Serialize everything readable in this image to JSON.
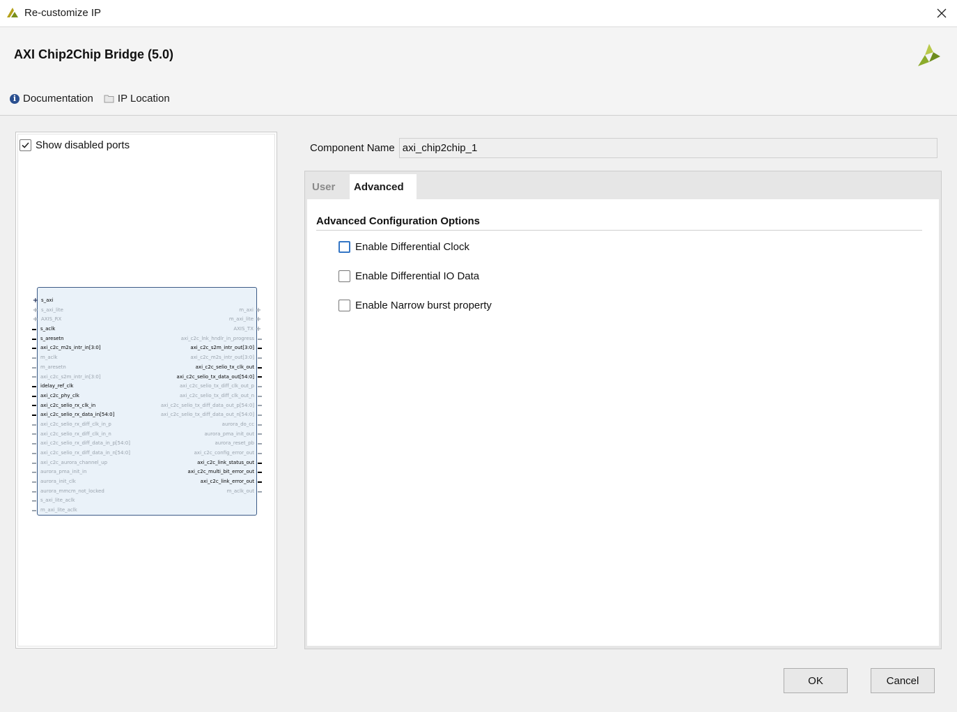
{
  "window": {
    "title": "Re-customize IP"
  },
  "header": {
    "ip_title": "AXI Chip2Chip Bridge (5.0)",
    "links": [
      {
        "label": "Documentation",
        "icon": "info-icon"
      },
      {
        "label": "IP Location",
        "icon": "folder-icon"
      }
    ]
  },
  "left_panel": {
    "show_disabled_ports": {
      "label": "Show disabled ports",
      "checked": true
    },
    "ports_left": [
      {
        "name": "s_axi",
        "enabled": true,
        "bus": true
      },
      {
        "name": "s_axi_lite",
        "enabled": false,
        "bus": true
      },
      {
        "name": "AXIS_RX",
        "enabled": false,
        "bus": true
      },
      {
        "name": "s_aclk",
        "enabled": true
      },
      {
        "name": "s_aresetn",
        "enabled": true
      },
      {
        "name": "axi_c2c_m2s_intr_in[3:0]",
        "enabled": true
      },
      {
        "name": "m_aclk",
        "enabled": false
      },
      {
        "name": "m_aresetn",
        "enabled": false
      },
      {
        "name": "axi_c2c_s2m_intr_in[3:0]",
        "enabled": false
      },
      {
        "name": "idelay_ref_clk",
        "enabled": true
      },
      {
        "name": "axi_c2c_phy_clk",
        "enabled": true
      },
      {
        "name": "axi_c2c_selio_rx_clk_in",
        "enabled": true
      },
      {
        "name": "axi_c2c_selio_rx_data_in[54:0]",
        "enabled": true
      },
      {
        "name": "axi_c2c_selio_rx_diff_clk_in_p",
        "enabled": false
      },
      {
        "name": "axi_c2c_selio_rx_diff_clk_in_n",
        "enabled": false
      },
      {
        "name": "axi_c2c_selio_rx_diff_data_in_p[54:0]",
        "enabled": false
      },
      {
        "name": "axi_c2c_selio_rx_diff_data_in_n[54:0]",
        "enabled": false
      },
      {
        "name": "axi_c2c_aurora_channel_up",
        "enabled": false
      },
      {
        "name": "aurora_pma_init_in",
        "enabled": false
      },
      {
        "name": "aurora_init_clk",
        "enabled": false
      },
      {
        "name": "aurora_mmcm_not_locked",
        "enabled": false
      },
      {
        "name": "s_axi_lite_aclk",
        "enabled": false
      },
      {
        "name": "m_axi_lite_aclk",
        "enabled": false
      }
    ],
    "ports_right": [
      {
        "name": "",
        "enabled": false
      },
      {
        "name": "m_axi",
        "enabled": false,
        "bus": true
      },
      {
        "name": "m_axi_lite",
        "enabled": false,
        "bus": true
      },
      {
        "name": "AXIS_TX",
        "enabled": false,
        "bus": true
      },
      {
        "name": "axi_c2c_lnk_hndlr_in_progress",
        "enabled": false
      },
      {
        "name": "axi_c2c_s2m_intr_out[3:0]",
        "enabled": true
      },
      {
        "name": "axi_c2c_m2s_intr_out[3:0]",
        "enabled": false
      },
      {
        "name": "axi_c2c_selio_tx_clk_out",
        "enabled": true
      },
      {
        "name": "axi_c2c_selio_tx_data_out[54:0]",
        "enabled": true
      },
      {
        "name": "axi_c2c_selio_tx_diff_clk_out_p",
        "enabled": false
      },
      {
        "name": "axi_c2c_selio_tx_diff_clk_out_n",
        "enabled": false
      },
      {
        "name": "axi_c2c_selio_tx_diff_data_out_p[54:0]",
        "enabled": false
      },
      {
        "name": "axi_c2c_selio_tx_diff_data_out_n[54:0]",
        "enabled": false
      },
      {
        "name": "aurora_do_cc",
        "enabled": false
      },
      {
        "name": "aurora_pma_init_out",
        "enabled": false
      },
      {
        "name": "aurora_reset_pb",
        "enabled": false
      },
      {
        "name": "axi_c2c_config_error_out",
        "enabled": false
      },
      {
        "name": "axi_c2c_link_status_out",
        "enabled": true
      },
      {
        "name": "axi_c2c_multi_bit_error_out",
        "enabled": true
      },
      {
        "name": "axi_c2c_link_error_out",
        "enabled": true
      },
      {
        "name": "m_aclk_out",
        "enabled": false
      }
    ]
  },
  "component": {
    "label": "Component Name",
    "value": "axi_chip2chip_1"
  },
  "tabs": [
    {
      "label": "User",
      "active": false
    },
    {
      "label": "Advanced",
      "active": true
    }
  ],
  "advanced": {
    "section_title": "Advanced Configuration Options",
    "options": [
      {
        "label": "Enable Differential Clock",
        "checked": false
      },
      {
        "label": "Enable Differential IO Data",
        "checked": false
      },
      {
        "label": "Enable Narrow burst property",
        "checked": false
      }
    ]
  },
  "buttons": {
    "ok": "OK",
    "cancel": "Cancel"
  },
  "colors": {
    "accent": "#3476c5",
    "block_fill": "#eaf2f9",
    "block_border": "#3b5a86",
    "logo": "#8bab2a"
  }
}
